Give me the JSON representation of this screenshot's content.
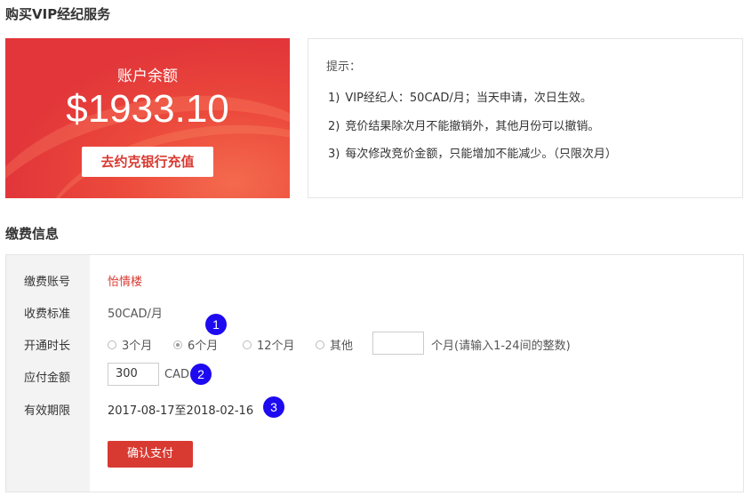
{
  "page": {
    "title": "购买VIP经纪服务",
    "section2_title": "缴费信息"
  },
  "balance": {
    "label": "账户余额",
    "amount": "$1933.10",
    "recharge_button": "去约克银行充值"
  },
  "tips": {
    "title": "提示：",
    "items": [
      {
        "num": "1)",
        "text": "VIP经纪人：50CAD/月；当天申请，次日生效。"
      },
      {
        "num": "2)",
        "text": "竞价结果除次月不能撤销外，其他月份可以撤销。"
      },
      {
        "num": "3)",
        "text": "每次修改竞价金额，只能增加不能减少。（只限次月）"
      }
    ]
  },
  "payment": {
    "rows": {
      "account": {
        "label": "缴费账号",
        "value": "怡情楼"
      },
      "rate": {
        "label": "收费标准",
        "value": "50CAD/月"
      },
      "duration": {
        "label": "开通时长"
      },
      "amount": {
        "label": "应付金额",
        "value": "300",
        "unit": "CAD"
      },
      "validity": {
        "label": "有效期限",
        "value": "2017-08-17至2018-02-16"
      }
    },
    "duration_options": [
      {
        "label": "3个月",
        "checked": false
      },
      {
        "label": "6个月",
        "checked": true
      },
      {
        "label": "12个月",
        "checked": false
      },
      {
        "label": "其他",
        "checked": false
      }
    ],
    "custom_months_value": "",
    "custom_months_hint": "个月(请输入1-24间的整数)",
    "confirm_button": "确认支付"
  },
  "markers": [
    "1",
    "2",
    "3"
  ],
  "colors": {
    "accent": "#d83a32",
    "marker": "#1e0af0"
  }
}
